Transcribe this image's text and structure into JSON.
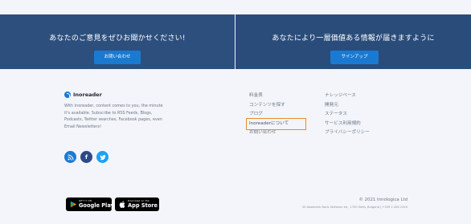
{
  "banner": {
    "left": {
      "headline": "あなたのご意見をぜひお聞かせください!",
      "button": "お問い合わせ"
    },
    "right": {
      "headline": "あなたにより一層価値ある情報が届きますように",
      "button": "サインアップ"
    }
  },
  "about": {
    "brand": "Inoreader",
    "description": "With Inoreader, content comes to you, the minute it's available. Subscribe to RSS Feeds, Blogs, Podcasts, Twitter searches, Facebook pages, even Email Newsletters!"
  },
  "social": [
    {
      "name": "rss-icon"
    },
    {
      "name": "facebook-icon",
      "glyph": "f"
    },
    {
      "name": "twitter-icon"
    }
  ],
  "links": {
    "col1": [
      "料金表",
      "コンテンツを探す",
      "ブログ",
      "Inoreaderについて",
      "お問い合わせ"
    ],
    "col2": [
      "ナレッジベース",
      "開発元",
      "ステータス",
      "サービス利用規約",
      "プライバシーポリシー"
    ],
    "highlighted": "Inoreaderについて",
    "highlight_color": "#e88b2b"
  },
  "stores": {
    "google": {
      "small": "GET IT ON",
      "big": "Google Play"
    },
    "apple": {
      "small": "Download on the",
      "big": "App Store"
    }
  },
  "copyright": "© 2021 Innologica Ltd",
  "address": "35 Akademik Boris Stefanov str., 1700 Sofia, Bulgaria | +359 2 426 2240",
  "colors": {
    "banner_bg": "#2d4f7e",
    "button_bg": "#1a7ad1",
    "footer_bg": "#f3f5fa"
  }
}
